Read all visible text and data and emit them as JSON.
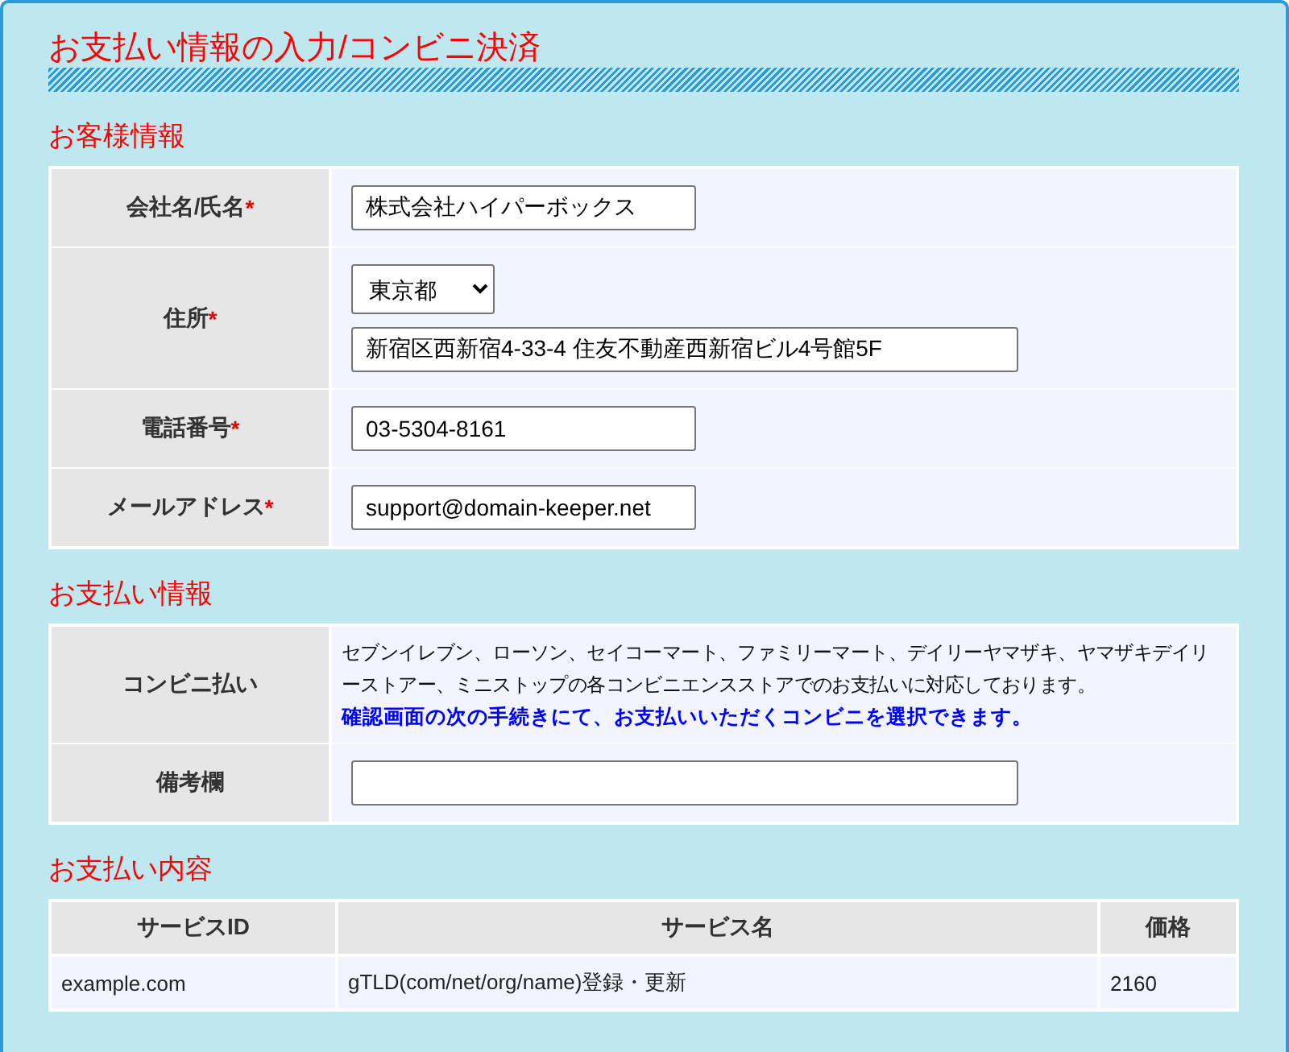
{
  "page_title": "お支払い情報の入力/コンビニ決済",
  "sections": [
    {
      "heading": "お客様情報",
      "rows": [
        {
          "label": "会社名/氏名",
          "required_mark": "*",
          "fields": [
            {
              "kind": "text",
              "value": "株式会社ハイパーボックス"
            }
          ]
        },
        {
          "label": "住所",
          "required_mark": "*",
          "fields": [
            {
              "kind": "select",
              "value": "東京都"
            },
            {
              "kind": "wide_text",
              "value": "新宿区西新宿4-33-4 住友不動産西新宿ビル4号館5F"
            }
          ]
        },
        {
          "label": "電話番号",
          "required_mark": "*",
          "fields": [
            {
              "kind": "text",
              "value": "03-5304-8161"
            }
          ]
        },
        {
          "label": "メールアドレス",
          "required_mark": "*",
          "fields": [
            {
              "kind": "text",
              "value": "support@domain-keeper.net"
            }
          ]
        }
      ]
    },
    {
      "heading": "お支払い情報",
      "rows": [
        {
          "label": "コンビニ払い",
          "texts": [
            {
              "kind": "plain",
              "text": "セブンイレブン、ローソン、セイコーマート、ファミリーマート、デイリーヤマザキ、ヤマザキデイリーストアー、ミニストップの各コンビニエンスストアでのお支払いに対応しております。"
            },
            {
              "kind": "notice",
              "text": "確認画面の次の手続きにて、お支払いいただくコンビニを選択できます。"
            }
          ]
        },
        {
          "label": "備考欄",
          "fields": [
            {
              "kind": "wide_text"
            }
          ]
        }
      ]
    }
  ],
  "payment_table": {
    "heading": "お支払い内容",
    "columns": [
      "サービスID",
      "サービス名",
      "価格"
    ],
    "rows": [
      [
        "example.com",
        "gTLD(com/net/org/name)登録・更新",
        "2160"
      ]
    ]
  }
}
